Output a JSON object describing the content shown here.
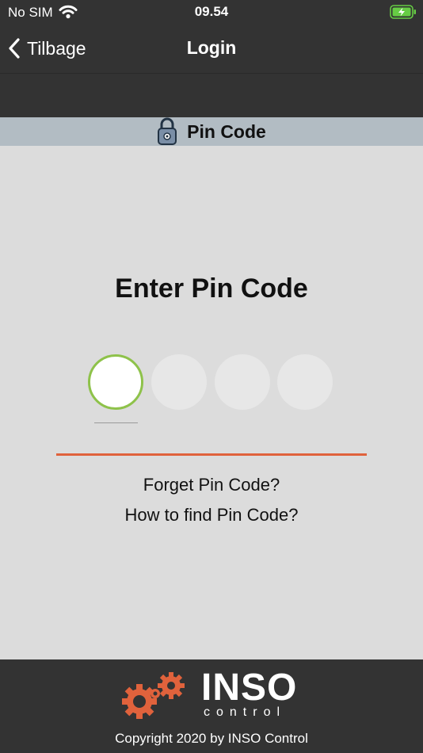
{
  "status_bar": {
    "carrier": "No SIM",
    "time": "09.54",
    "wifi_icon": "wifi-icon",
    "battery_icon": "battery-charging-icon"
  },
  "nav": {
    "back_label": "Tilbage",
    "title": "Login",
    "back_icon": "chevron-left-icon"
  },
  "section": {
    "label": "Pin Code",
    "icon": "lock-icon"
  },
  "pin_entry": {
    "heading": "Enter Pin Code",
    "digits_total": 4,
    "digits_entered": 0,
    "active_index": 0
  },
  "links": {
    "forget": "Forget Pin Code?",
    "how_to_find": "How to find Pin Code?"
  },
  "footer": {
    "brand": "INSO",
    "brand_sub": "control",
    "copyright": "Copyright 2020 by INSO Control",
    "logo_icon": "inso-gears-logo-icon"
  },
  "colors": {
    "bar_background": "#333333",
    "header_band": "#b2bcc3",
    "content_background": "#dcdcdc",
    "active_ring": "#8ec24a",
    "error_line": "#e0623c",
    "brand_orange": "#e0623c",
    "battery_green": "#66cc44"
  }
}
